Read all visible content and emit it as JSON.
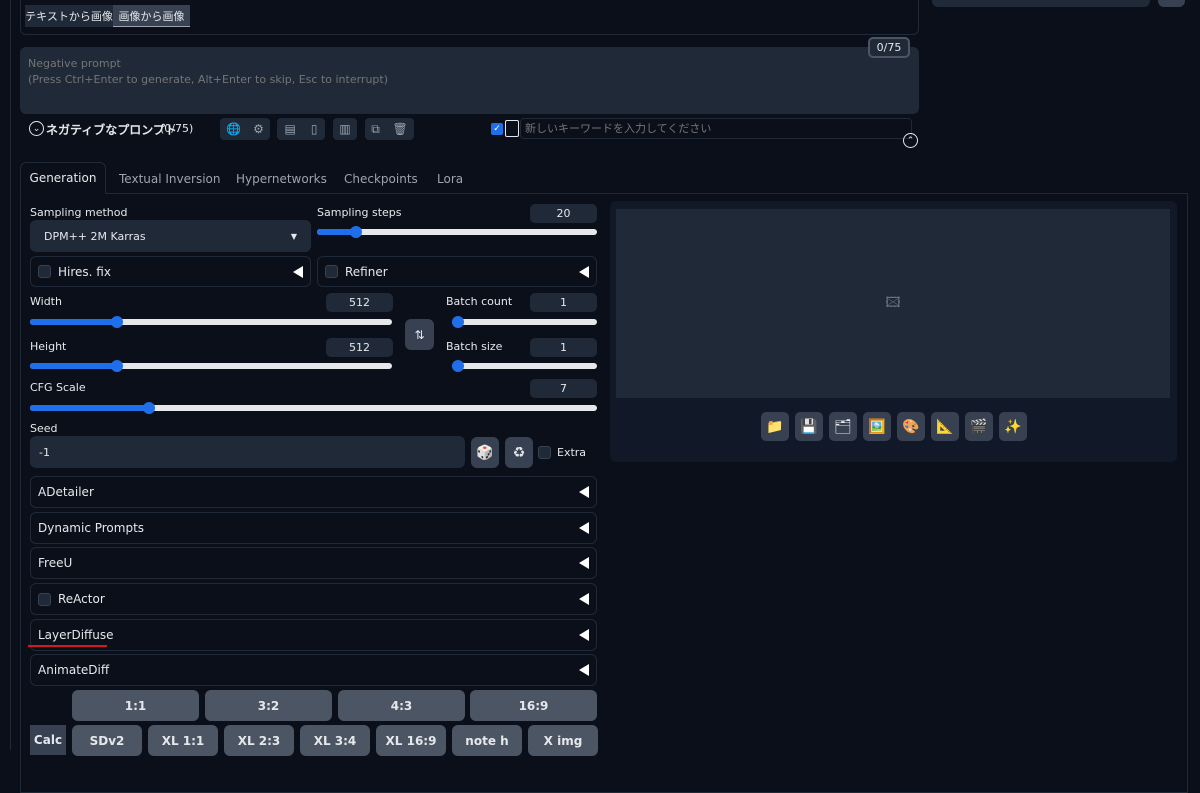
{
  "mode_tabs": [
    {
      "label": "テキストから画像"
    },
    {
      "label": "画像から画像"
    }
  ],
  "negative": {
    "placeholder": "Negative prompt\n(Press Ctrl+Enter to generate, Alt+Enter to skip, Esc to interrupt)",
    "counter": "0/75"
  },
  "toolbar": {
    "label": "ネガティブなプロンプト",
    "count": "(0/75)",
    "keyword_placeholder": "新しいキーワードを入力してください",
    "keyword_checked": true
  },
  "tabs": [
    {
      "label": "Generation",
      "active": true
    },
    {
      "label": "Textual Inversion"
    },
    {
      "label": "Hypernetworks"
    },
    {
      "label": "Checkpoints"
    },
    {
      "label": "Lora"
    }
  ],
  "sampling": {
    "method_label": "Sampling method",
    "method": "DPM++ 2M Karras",
    "steps_label": "Sampling steps",
    "steps": "20",
    "steps_fraction": 0.14
  },
  "hires": {
    "label": "Hires. fix"
  },
  "refiner": {
    "label": "Refiner"
  },
  "width": {
    "label": "Width",
    "value": "512",
    "fraction": 0.24
  },
  "height": {
    "label": "Height",
    "value": "512",
    "fraction": 0.24
  },
  "batch_count": {
    "label": "Batch count",
    "value": "1",
    "fraction": 0
  },
  "batch_size": {
    "label": "Batch size",
    "value": "1",
    "fraction": 0
  },
  "cfg": {
    "label": "CFG Scale",
    "value": "7",
    "fraction": 0.21
  },
  "seed": {
    "label": "Seed",
    "value": "-1",
    "extra": "Extra"
  },
  "accordions": [
    {
      "label": "ADetailer"
    },
    {
      "label": "Dynamic Prompts"
    },
    {
      "label": "FreeU"
    },
    {
      "label": "ReActor",
      "checkbox": true
    },
    {
      "label": "LayerDiffuse",
      "underline_color": "#d11a1a"
    },
    {
      "label": "AnimateDiff"
    }
  ],
  "ratios": [
    "1:1",
    "3:2",
    "4:3",
    "16:9"
  ],
  "presets": {
    "calc": "Calc",
    "items": [
      "SDv2",
      "XL 1:1",
      "XL 2:3",
      "XL 3:4",
      "XL 16:9",
      "note h",
      "X img"
    ]
  },
  "output_icons": [
    {
      "name": "folder",
      "glyph": "📁"
    },
    {
      "name": "save",
      "glyph": "💾"
    },
    {
      "name": "zip",
      "glyph": "🗂"
    },
    {
      "name": "send-to-img2img",
      "glyph": "🖼️"
    },
    {
      "name": "send-to-inpaint",
      "glyph": "🎨"
    },
    {
      "name": "send-to-extras",
      "glyph": "📐"
    },
    {
      "name": "clapper",
      "glyph": "🎬"
    },
    {
      "name": "sparkles",
      "glyph": "✨"
    }
  ],
  "colors": {
    "accent": "#1f6feb",
    "background": "#0b0f19",
    "input": "#1f2937"
  }
}
